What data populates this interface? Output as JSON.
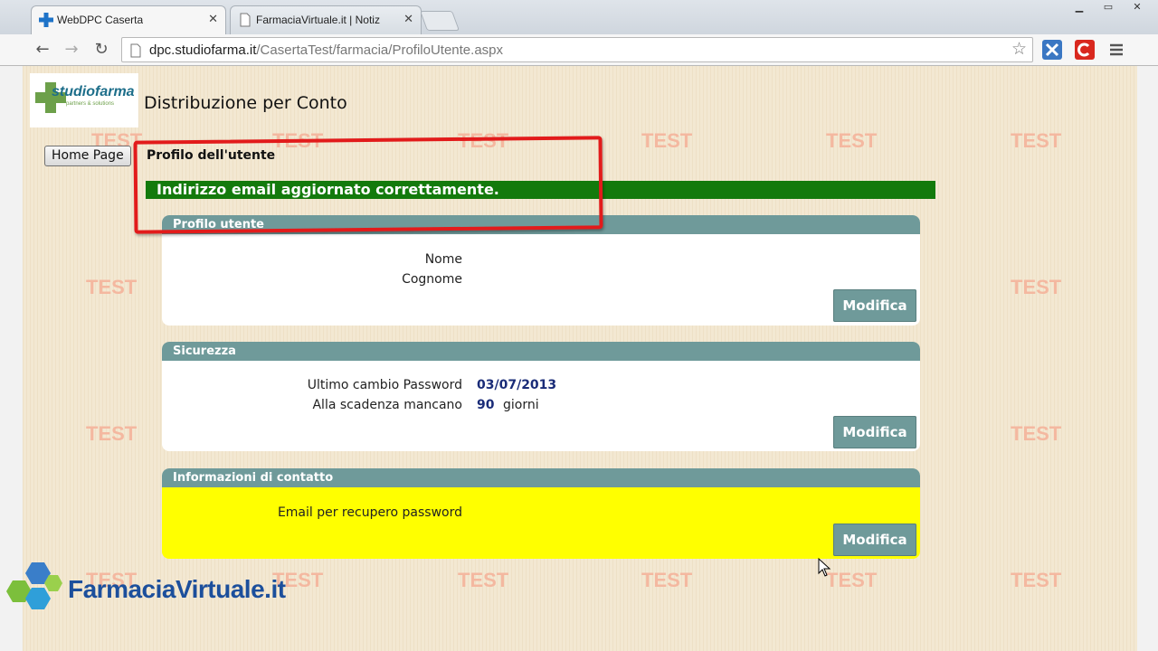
{
  "browser": {
    "tabs": [
      {
        "title": "WebDPC Caserta",
        "active": true
      },
      {
        "title": "FarmaciaVirtuale.it | Notiz",
        "active": false
      }
    ],
    "url_host": "dpc.studiofarma.it",
    "url_path": "/CasertaTest/farmacia/ProfiloUtente.aspx"
  },
  "header": {
    "logo_text": "studiofarma",
    "logo_sub": "partners & solutions",
    "title": "Distribuzione per Conto"
  },
  "nav": {
    "home_label": "Home Page"
  },
  "section_title": "Profilo dell'utente",
  "success_message": "Indirizzo email aggiornato correttamente.",
  "watermark": "TEST",
  "panels": {
    "profile": {
      "title": "Profilo utente",
      "nome_label": "Nome",
      "cognome_label": "Cognome",
      "edit_label": "Modifica"
    },
    "security": {
      "title": "Sicurezza",
      "last_change_label": "Ultimo cambio Password",
      "last_change_value": "03/07/2013",
      "expiry_label": "Alla scadenza mancano",
      "expiry_value": "90",
      "expiry_unit": "giorni",
      "edit_label": "Modifica"
    },
    "contact": {
      "title": "Informazioni di contatto",
      "email_label": "Email per recupero password",
      "edit_label": "Modifica"
    }
  },
  "overlay": {
    "brand": "FarmaciaVirtuale.it"
  },
  "colors": {
    "panel_header": "#6f9a9a",
    "success": "#137a0c",
    "highlight": "#ffff00",
    "annotation": "#e21b1b"
  }
}
